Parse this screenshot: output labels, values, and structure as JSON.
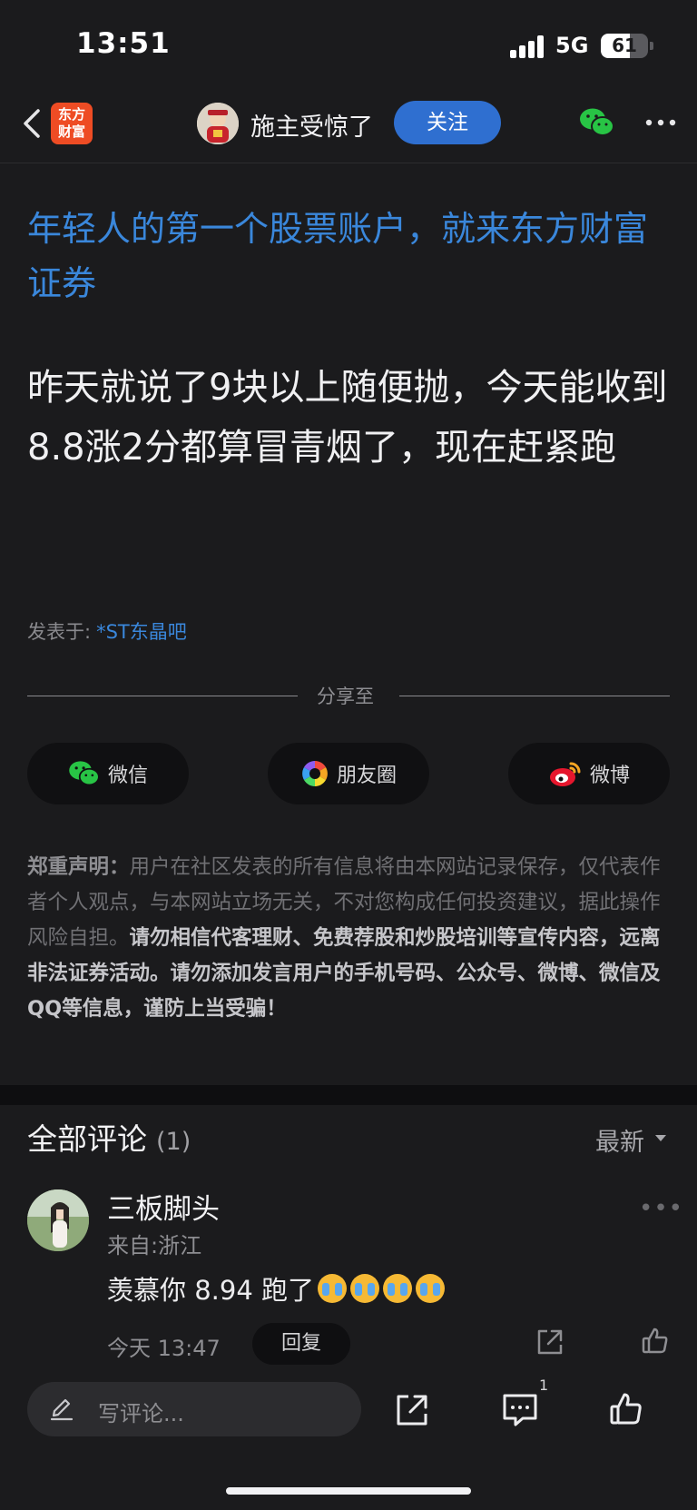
{
  "status": {
    "time": "13:51",
    "network": "5G",
    "battery": "61",
    "battery_level": 0.61
  },
  "nav": {
    "app_logo_line1": "东方",
    "app_logo_line2": "财富",
    "author": "施主受惊了",
    "follow_label": "关注"
  },
  "post": {
    "ad_text": "年轻人的第一个股票账户，就来东方财富证券",
    "body": "昨天就说了9块以上随便抛，今天能收到8.8涨2分都算冒青烟了，现在赶紧跑",
    "posted_label": "发表于:",
    "posted_bar": "*ST东晶吧"
  },
  "share": {
    "title": "分享至",
    "buttons": [
      {
        "label": "微信",
        "icon": "wechat-icon"
      },
      {
        "label": "朋友圈",
        "icon": "moments-icon"
      },
      {
        "label": "微博",
        "icon": "weibo-icon"
      }
    ]
  },
  "disclaimer": {
    "prefix": "郑重声明：",
    "normal": "用户在社区发表的所有信息将由本网站记录保存，仅代表作者个人观点，与本网站立场无关，不对您构成任何投资建议，据此操作风险自担。",
    "strong": "请勿相信代客理财、免费荐股和炒股培训等宣传内容，远离非法证券活动。请勿添加发言用户的手机号码、公众号、微博、微信及QQ等信息，谨防上当受骗！"
  },
  "comments": {
    "title": "全部评论",
    "count": "(1)",
    "sort": "最新",
    "items": [
      {
        "name": "三板脚头",
        "location": "来自:浙江",
        "text": "羡慕你 8.94 跑了",
        "emoji_count": 4,
        "time": "今天 13:47",
        "reply_label": "回复"
      }
    ]
  },
  "bottombar": {
    "placeholder": "写评论...",
    "comment_badge": "1"
  },
  "colors": {
    "accent": "#2f6fd0",
    "link": "#3a87db",
    "background": "#1b1b1d"
  }
}
